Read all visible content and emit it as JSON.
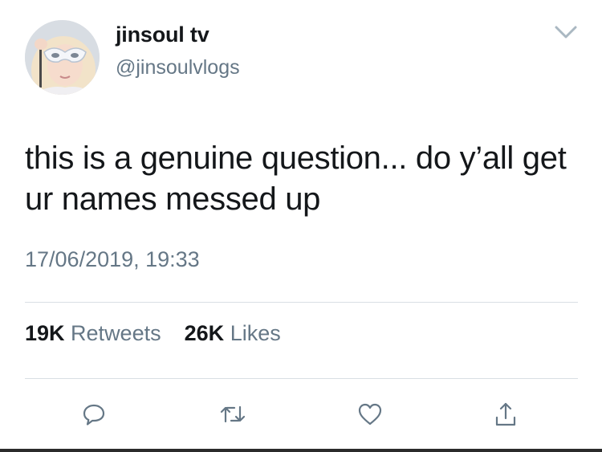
{
  "tweet": {
    "display_name": "jinsoul tv",
    "handle": "@jinsoulvlogs",
    "text": "this is a genuine question... do y’all get ur names messed up",
    "timestamp": "17/06/2019, 19:33"
  },
  "stats": {
    "retweets_count": "19K",
    "retweets_label": "Retweets",
    "likes_count": "26K",
    "likes_label": "Likes"
  },
  "actions": {
    "reply_icon": "speech-bubble",
    "retweet_icon": "retweet-arrows",
    "like_icon": "heart",
    "share_icon": "share-upload"
  },
  "colors": {
    "text_primary": "#14171a",
    "text_secondary": "#657786",
    "divider": "#d9dfe4",
    "icon": "#657786"
  }
}
